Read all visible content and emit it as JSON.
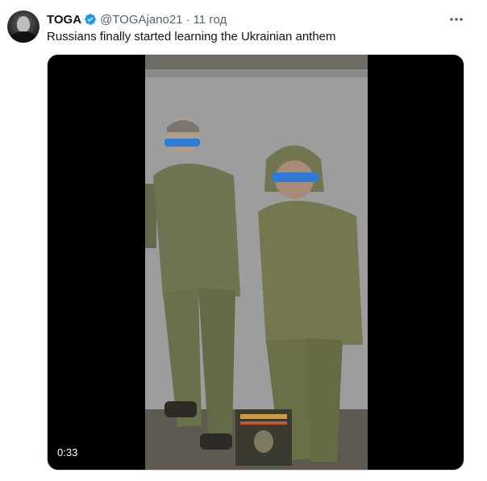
{
  "tweet": {
    "author_name": "TOGA",
    "author_handle": "@TOGAjano21",
    "separator": "·",
    "time": "11 год",
    "text": "Russians finally started learning the Ukrainian anthem",
    "verified_color": "#1d9bf0",
    "icons": {
      "verified": "verified-badge-icon",
      "more": "more-dots-icon"
    }
  },
  "media": {
    "duration": "0:33",
    "overlay_caption": "",
    "colors": {
      "wall": "#9a9c9a",
      "camo": "#6f7350",
      "blindfold": "#2f7bd6"
    }
  }
}
